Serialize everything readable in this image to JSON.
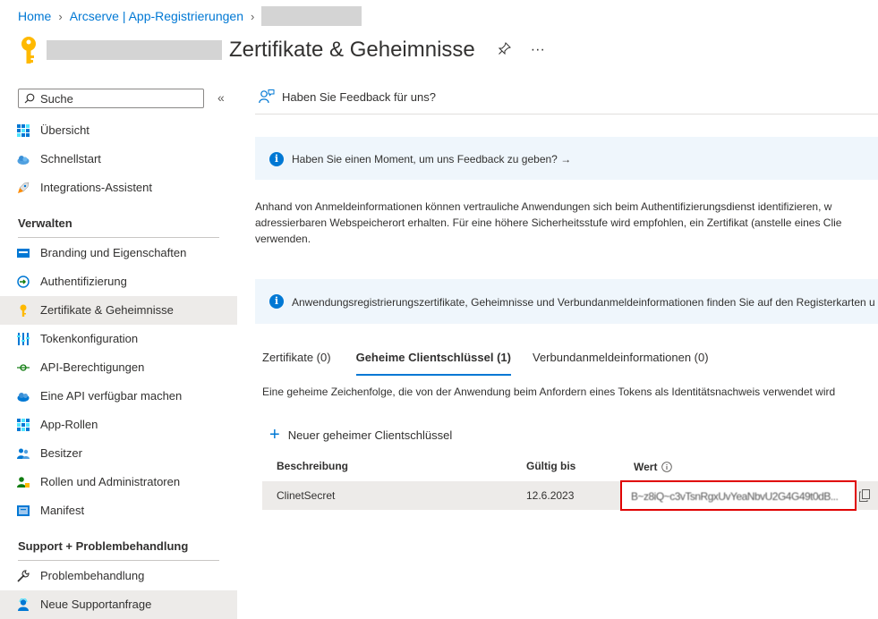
{
  "breadcrumb": {
    "home": "Home",
    "app_registrations": "Arcserve | App-Registrierungen"
  },
  "header": {
    "title": "Zertifikate & Geheimnisse",
    "pin": "✲",
    "more": "···"
  },
  "sidebar": {
    "search_placeholder": "Suche",
    "collapse": "«",
    "top_items": [
      {
        "label": "Übersicht",
        "icon": "grid-icon"
      },
      {
        "label": "Schnellstart",
        "icon": "cloud-icon"
      },
      {
        "label": "Integrations-Assistent",
        "icon": "rocket-icon"
      }
    ],
    "section_manage": "Verwalten",
    "manage_items": [
      {
        "label": "Branding und Eigenschaften",
        "icon": "branding-icon"
      },
      {
        "label": "Authentifizierung",
        "icon": "auth-icon"
      },
      {
        "label": "Zertifikate & Geheimnisse",
        "icon": "key-icon",
        "active": true
      },
      {
        "label": "Tokenkonfiguration",
        "icon": "token-icon"
      },
      {
        "label": "API-Berechtigungen",
        "icon": "api-permissions-icon"
      },
      {
        "label": "Eine API verfügbar machen",
        "icon": "expose-api-icon"
      },
      {
        "label": "App-Rollen",
        "icon": "app-roles-icon"
      },
      {
        "label": "Besitzer",
        "icon": "owners-icon"
      },
      {
        "label": "Rollen und Administratoren",
        "icon": "roles-admins-icon"
      },
      {
        "label": "Manifest",
        "icon": "manifest-icon"
      }
    ],
    "section_support": "Support + Problembehandlung",
    "support_items": [
      {
        "label": "Problembehandlung",
        "icon": "wrench-icon"
      },
      {
        "label": "Neue Supportanfrage",
        "icon": "support-person-icon"
      }
    ]
  },
  "main": {
    "feedback_label": "Haben Sie Feedback für uns?",
    "info1": "Haben Sie einen Moment, um uns Feedback zu geben? →",
    "paragraph_lines": [
      "Anhand von Anmeldeinformationen können vertrauliche Anwendungen sich beim Authentifizierungsdienst identifizieren, w",
      "adressierbaren Webspeicherort erhalten. Für eine höhere Sicherheitsstufe wird empfohlen, ein Zertifikat (anstelle eines Clie",
      "verwenden."
    ],
    "info2": "Anwendungsregistrierungszertifikate, Geheimnisse und Verbundanmeldeinformationen finden Sie auf den Registerkarten u",
    "tabs": [
      {
        "label": "Zertifikate (0)"
      },
      {
        "label": "Geheime Clientschlüssel (1)",
        "active": true
      },
      {
        "label": "Verbundanmeldeinformationen (0)"
      }
    ],
    "tab_description": "Eine geheime Zeichenfolge, die von der Anwendung beim Anfordern eines Tokens als Identitätsnachweis verwendet wird",
    "new_secret_label": "Neuer geheimer Clientschlüssel",
    "table": {
      "headers": {
        "description": "Beschreibung",
        "valid_until": "Gültig bis",
        "value": "Wert"
      },
      "rows": [
        {
          "description": "ClinetSecret",
          "valid_until": "12.6.2023",
          "value": "B~z8iQ~c3vTsnRgxUvYeaNbvU2G4G49t0dB..."
        }
      ]
    }
  },
  "colors": {
    "accent": "#0078d4",
    "highlight_border": "#e00000",
    "info_bg": "#eff6fc"
  }
}
